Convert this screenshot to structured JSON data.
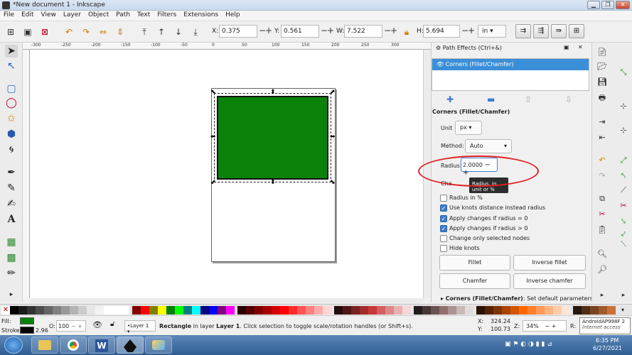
{
  "window": {
    "title": "*New document 1 - Inkscape"
  },
  "menu": [
    "File",
    "Edit",
    "View",
    "Layer",
    "Object",
    "Path",
    "Text",
    "Filters",
    "Extensions",
    "Help"
  ],
  "toolbar": {
    "x_label": "X:",
    "x_value": "0.375",
    "y_label": "Y:",
    "y_value": "0.561",
    "w_label": "W:",
    "w_value": "7.522",
    "h_label": "H:",
    "h_value": "5.694",
    "unit": "in",
    "plus": "+",
    "minus": "−"
  },
  "ruler": {
    "ticks": [
      "-300",
      "-250",
      "-200",
      "-150",
      "-100",
      "-50",
      "0",
      "50",
      "100",
      "150",
      "200",
      "250",
      "300"
    ]
  },
  "panel": {
    "title": "Path Effects (Ctrl+&)",
    "effects": [
      "Corners (Fillet/Chamfer)"
    ],
    "section_title": "Corners (Fillet/Chamfer)",
    "unit_label": "Unit",
    "unit_value": "px",
    "method_label": "Method:",
    "method_value": "Auto",
    "radius_label": "Radius:",
    "radius_value": "2.0000",
    "chamfer_steps_partial": "Cha",
    "tooltip": "Radius, in unit or %",
    "checkboxes": [
      {
        "label": "Radius in %",
        "checked": false
      },
      {
        "label": "Use knots distance instead radius",
        "checked": true
      },
      {
        "label": "Apply changes if radius = 0",
        "checked": true
      },
      {
        "label": "Apply changes if radius > 0",
        "checked": true
      },
      {
        "label": "Change only selected nodes",
        "checked": false
      },
      {
        "label": "Hide knots",
        "checked": false
      }
    ],
    "buttons": {
      "fillet": "Fillet",
      "inverse_fillet": "Inverse fillet",
      "chamfer": "Chamfer",
      "inverse_chamfer": "Inverse chamfer"
    },
    "footer_bold": "Corners (Fillet/Chamfer)",
    "footer_text": ": Set default parameters"
  },
  "status": {
    "fill_label": "Fill:",
    "stroke_label": "Stroke:",
    "stroke_width": "2.96",
    "opacity_label": "O:",
    "opacity_value": "100",
    "layer": "•Layer 1",
    "message_bold": "Rectangle",
    "message_mid": " in layer ",
    "message_layer": "Layer 1",
    "message_end": ". Click selection to toggle scale/rotation handles (or Shift+s).",
    "x_label": "X:",
    "x_value": "324.24",
    "y_label": "Y:",
    "y_value": "100.73",
    "zoom_label": "Z:",
    "zoom_value": "34%",
    "rotate_label": "R:",
    "network_name": "AndroidAP998F 2",
    "network_status": "Internet access"
  },
  "taskbar": {
    "time": "6:35 PM",
    "date": "6/27/2021"
  },
  "colors": {
    "rect_fill": "#0a820a",
    "selection_blue": "#3b8fd9",
    "annotation_red": "#e02020"
  }
}
